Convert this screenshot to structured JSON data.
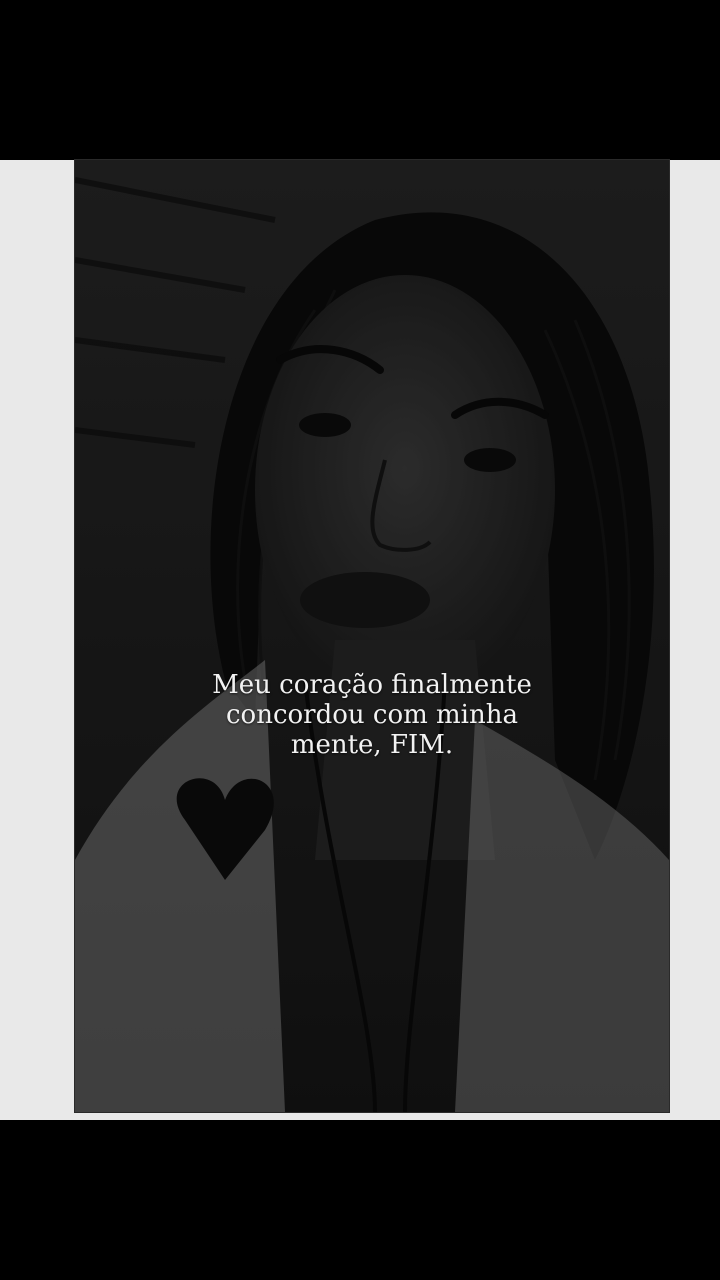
{
  "story": {
    "caption_lines": [
      "Meu coração finalmente",
      "concordou com minha",
      "mente, FIM."
    ]
  },
  "colors": {
    "letterbox": "#000000",
    "mat": "#e9e9e9",
    "caption": "#f2f2f2"
  }
}
